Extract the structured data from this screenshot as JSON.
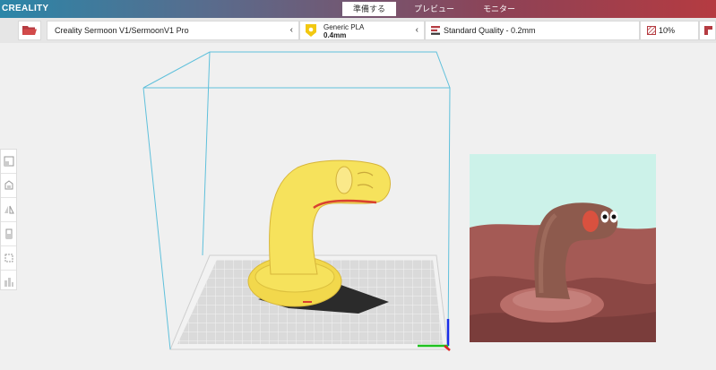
{
  "app": {
    "logo": "CREALITY"
  },
  "tabs": [
    {
      "label": "準備する",
      "active": true
    },
    {
      "label": "プレビュー",
      "active": false
    },
    {
      "label": "モニター",
      "active": false
    }
  ],
  "toolbar": {
    "printer": "Creality Sermoon V1/SermoonV1 Pro",
    "material_name": "Generic PLA",
    "nozzle": "0.4mm",
    "quality": "Standard Quality - 0.2mm",
    "infill": "10%"
  },
  "icons": {
    "open": "folder-icon",
    "material": "spool-icon",
    "quality": "layers-icon",
    "infill": "infill-icon",
    "support": "support-icon",
    "sidebar": [
      "scale-icon",
      "rotate-icon",
      "mirror-icon",
      "per-model-settings-icon",
      "support-blocker-icon",
      "arrange-icon"
    ]
  },
  "colors": {
    "accent": "#2b86a8",
    "brand_red": "#b53b41",
    "model_yellow": "#f6e25c",
    "build_volume": "#5fc0db"
  }
}
